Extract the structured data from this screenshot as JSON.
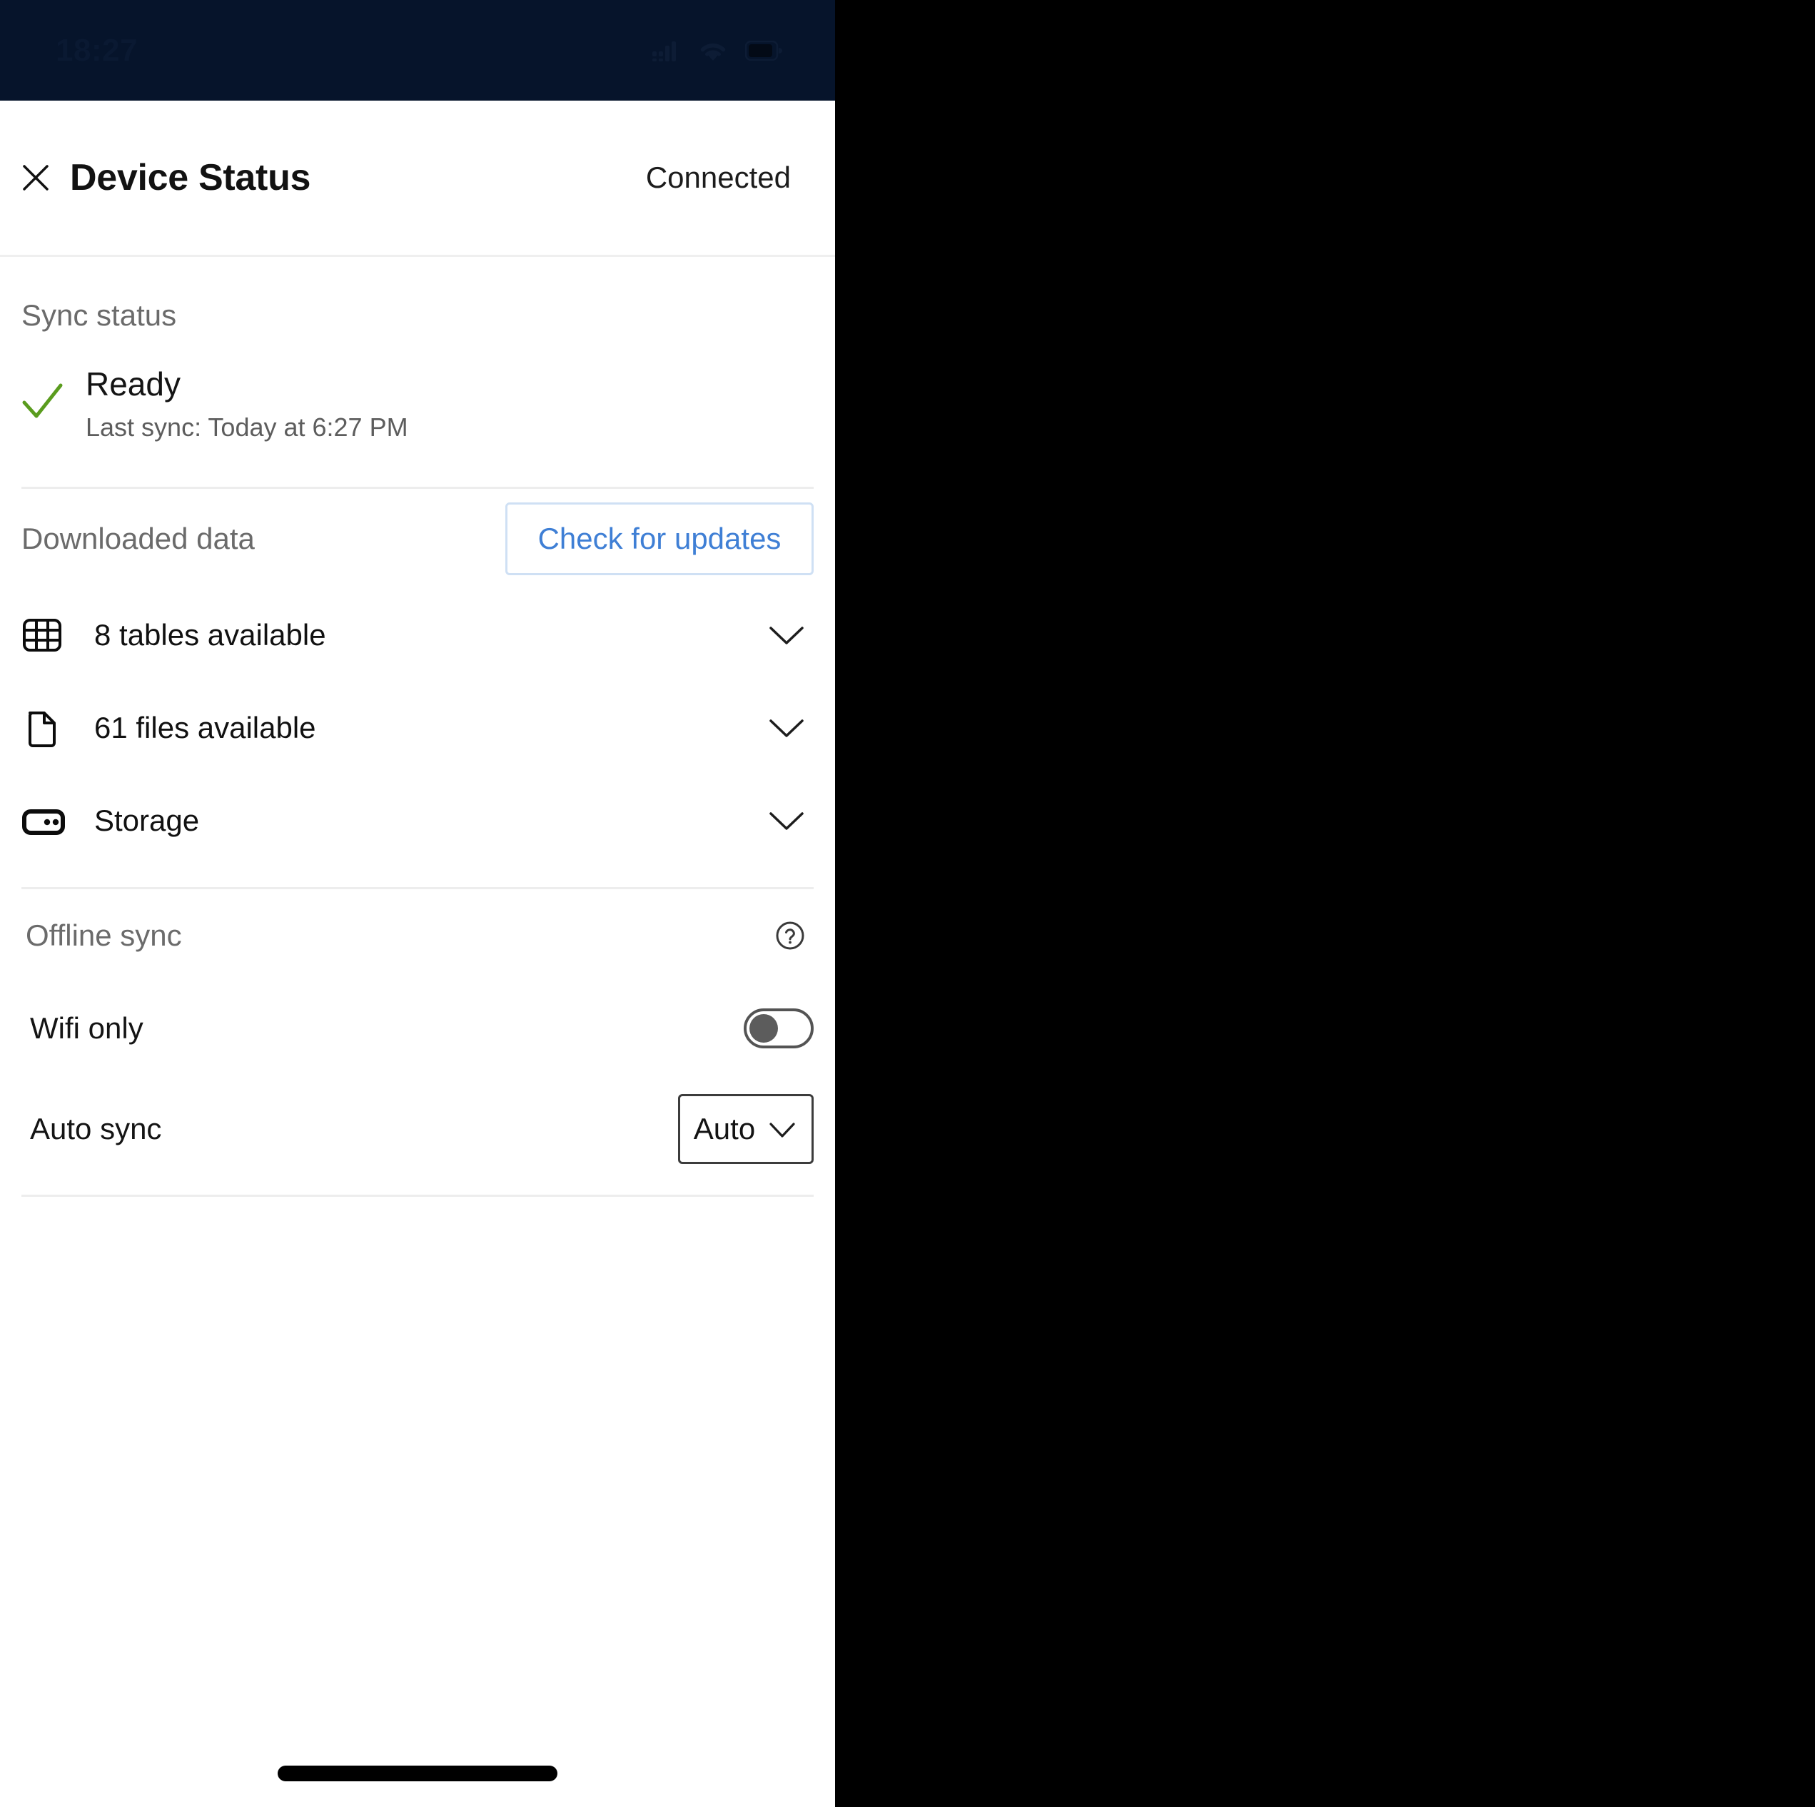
{
  "status_bar": {
    "time": "18:27",
    "icons": [
      "cellular-signal-icon",
      "wifi-icon",
      "battery-icon"
    ]
  },
  "header": {
    "close_icon": "close-icon",
    "title": "Device Status",
    "connection_status": "Connected"
  },
  "sync_status": {
    "heading": "Sync status",
    "check_icon": "check-icon",
    "check_color": "#5a9c1e",
    "state": "Ready",
    "last_sync": "Last sync: Today at 6:27 PM"
  },
  "downloaded_data": {
    "heading": "Downloaded data",
    "check_updates_label": "Check for updates",
    "accent_color": "#3f7fd5",
    "rows": [
      {
        "icon": "table-icon",
        "label": "8 tables available",
        "chevron": "chevron-down-icon"
      },
      {
        "icon": "file-icon",
        "label": "61 files available",
        "chevron": "chevron-down-icon"
      },
      {
        "icon": "storage-icon",
        "label": "Storage",
        "chevron": "chevron-down-icon"
      }
    ]
  },
  "offline_sync": {
    "heading": "Offline sync",
    "help_icon": "help-circle-icon",
    "wifi_only": {
      "label": "Wifi only",
      "value": "off"
    },
    "auto_sync": {
      "label": "Auto sync",
      "value": "Auto",
      "chevron": "chevron-down-icon"
    }
  }
}
